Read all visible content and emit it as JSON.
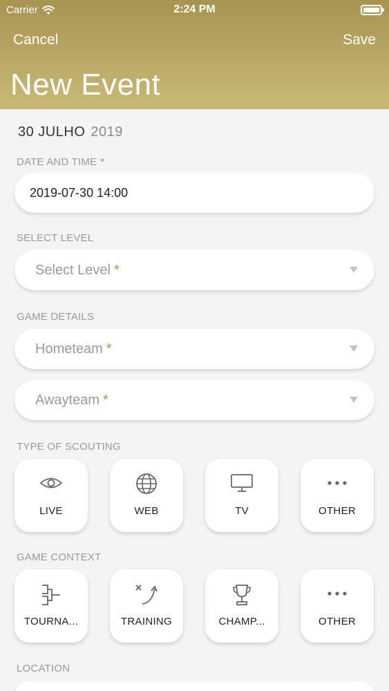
{
  "status_bar": {
    "carrier": "Carrier",
    "time": "2:24 PM"
  },
  "header": {
    "cancel_label": "Cancel",
    "save_label": "Save",
    "title": "New Event"
  },
  "date_header": {
    "day_month": "30 JULHO",
    "year": "2019"
  },
  "date_time": {
    "label": "DATE AND TIME",
    "required_mark": "*",
    "value": "2019-07-30 14:00"
  },
  "select_level": {
    "label": "SELECT LEVEL",
    "placeholder": "Select Level",
    "required_mark": "*"
  },
  "game_details": {
    "label": "GAME DETAILS",
    "hometeam_placeholder": "Hometeam",
    "awayteam_placeholder": "Awayteam",
    "required_mark": "*"
  },
  "type_of_scouting": {
    "label": "TYPE OF SCOUTING",
    "options": [
      {
        "label": "LIVE",
        "icon": "eye-icon"
      },
      {
        "label": "WEB",
        "icon": "globe-icon"
      },
      {
        "label": "TV",
        "icon": "monitor-icon"
      },
      {
        "label": "OTHER",
        "icon": "more-dots-icon"
      }
    ]
  },
  "game_context": {
    "label": "GAME CONTEXT",
    "options": [
      {
        "label": "TOURNA...",
        "icon": "bracket-icon"
      },
      {
        "label": "TRAINING",
        "icon": "tactics-icon"
      },
      {
        "label": "CHAMP...",
        "icon": "trophy-icon"
      },
      {
        "label": "OTHER",
        "icon": "more-dots-icon"
      }
    ]
  },
  "location": {
    "label": "LOCATION"
  },
  "colors": {
    "header_gold": "#b8a561",
    "required_gold": "#a89452",
    "background": "#f4f4f4"
  }
}
